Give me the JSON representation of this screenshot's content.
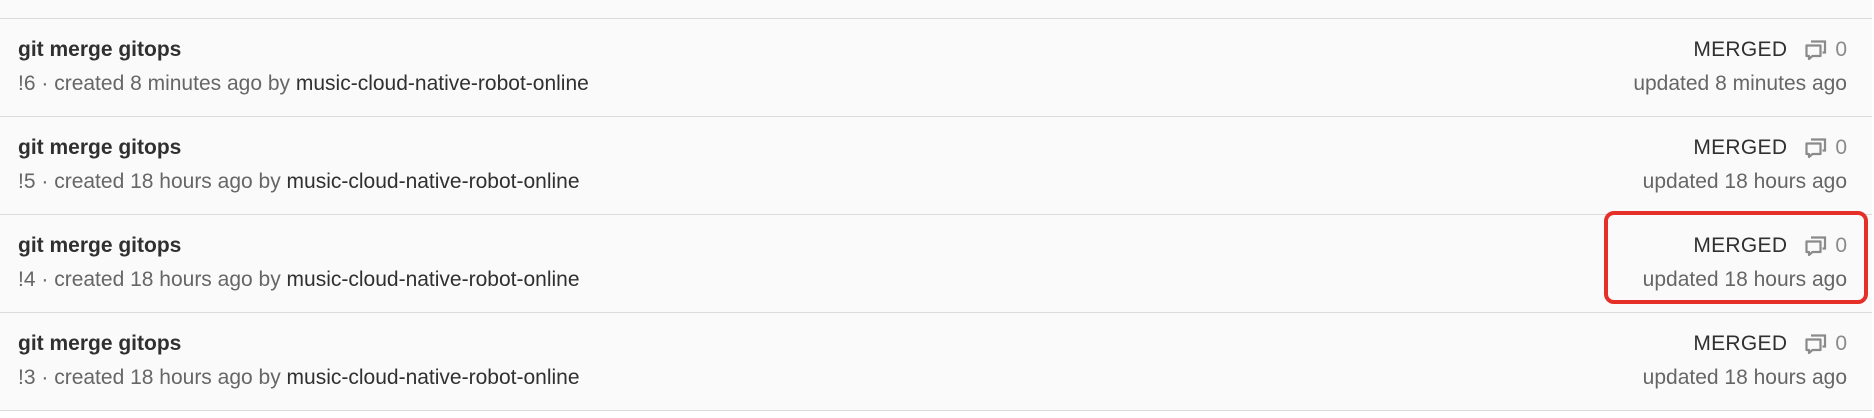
{
  "merge_requests": [
    {
      "title": "git merge gitops",
      "ref": "!6",
      "created_text": "created 8 minutes ago by",
      "author": "music-cloud-native-robot-online",
      "status": "MERGED",
      "comments": "0",
      "updated": "updated 8 minutes ago"
    },
    {
      "title": "git merge gitops",
      "ref": "!5",
      "created_text": "created 18 hours ago by",
      "author": "music-cloud-native-robot-online",
      "status": "MERGED",
      "comments": "0",
      "updated": "updated 18 hours ago"
    },
    {
      "title": "git merge gitops",
      "ref": "!4",
      "created_text": "created 18 hours ago by",
      "author": "music-cloud-native-robot-online",
      "status": "MERGED",
      "comments": "0",
      "updated": "updated 18 hours ago"
    },
    {
      "title": "git merge gitops",
      "ref": "!3",
      "created_text": "created 18 hours ago by",
      "author": "music-cloud-native-robot-online",
      "status": "MERGED",
      "comments": "0",
      "updated": "updated 18 hours ago"
    }
  ],
  "separator": "·",
  "icons": {
    "comments": "comments-icon"
  },
  "colors": {
    "highlight": "#e5302a",
    "divider": "#dbdbdb",
    "background": "#fafafa"
  }
}
